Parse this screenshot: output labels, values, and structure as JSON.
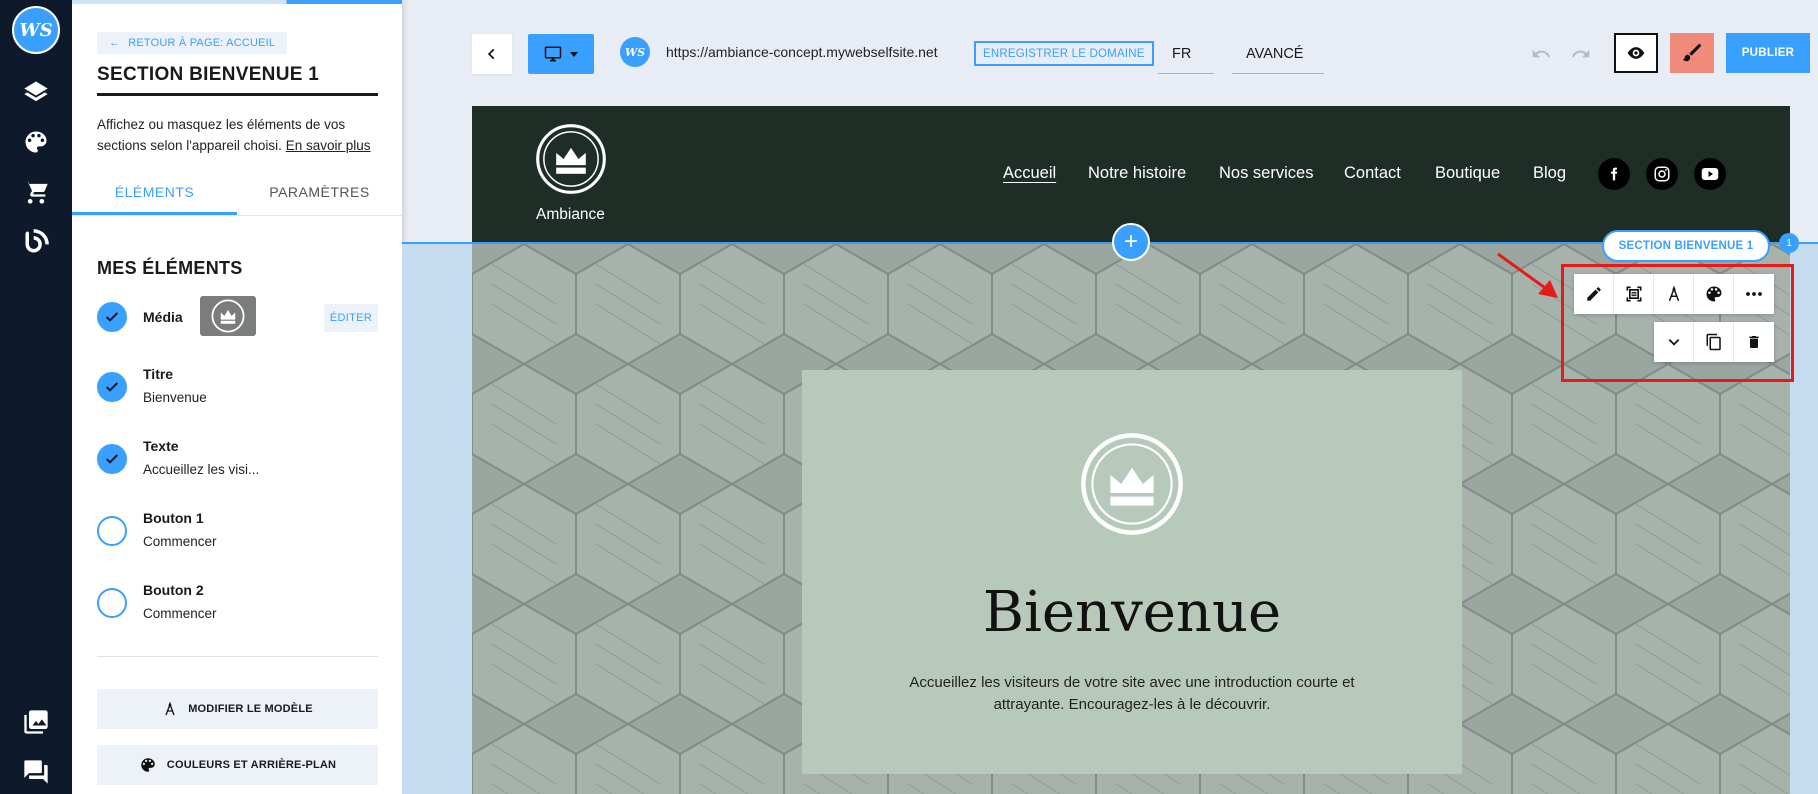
{
  "rail": {
    "logo": "WS"
  },
  "panel": {
    "back_link": "RETOUR À PAGE: ACCUEIL",
    "title": "SECTION BIENVENUE 1",
    "desc": "Affichez ou masquez les éléments de vos sections selon l'appareil choisi.",
    "learn_more": "En savoir plus",
    "tabs": [
      "ÉLÉMENTS",
      "PARAMÈTRES"
    ],
    "section_heading": "MES ÉLÉMENTS",
    "elements": [
      {
        "name": "Média",
        "sub": "",
        "checked": true
      },
      {
        "name": "Titre",
        "sub": "Bienvenue",
        "checked": true
      },
      {
        "name": "Texte",
        "sub": "Accueillez les visi...",
        "checked": true
      },
      {
        "name": "Bouton 1",
        "sub": "Commencer",
        "checked": false
      },
      {
        "name": "Bouton 2",
        "sub": "Commencer",
        "checked": false
      }
    ],
    "edit_label": "ÉDITER",
    "modify_template": "MODIFIER LE MODÈLE",
    "colors_bg": "COULEURS ET ARRIÈRE-PLAN"
  },
  "toolbar": {
    "url": "https://ambiance-concept.mywebselfsite.net",
    "domain_button": "ENREGISTRER LE DOMAINE",
    "language": "FR",
    "mode": "AVANCÉ",
    "publish": "PUBLIER",
    "site_logo": "WS"
  },
  "site": {
    "brand": "Ambiance",
    "nav": [
      "Accueil",
      "Notre histoire",
      "Nos services",
      "Contact",
      "Boutique",
      "Blog"
    ],
    "hero_title": "Bienvenue",
    "hero_text": "Accueillez les visiteurs de votre site avec une introduction courte et attrayante. Encouragez-les à le découvrir."
  },
  "section_pill": "SECTION BIENVENUE 1",
  "section_badge": "1",
  "add_label": "+",
  "colors": {
    "accent": "#3aa0ff",
    "rail": "#0e1a2b",
    "header": "#1f2d27",
    "card": "#b7c9bb",
    "highlight": "#e51b1b",
    "design": "#f08a7a"
  }
}
